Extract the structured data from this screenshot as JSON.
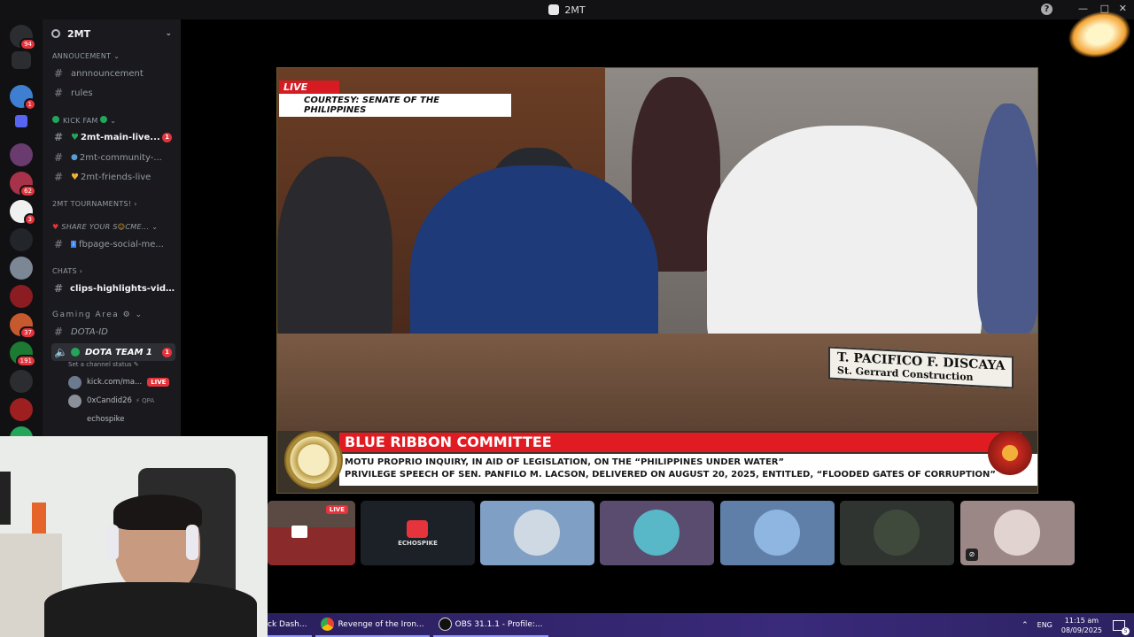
{
  "window": {
    "title": "2MT"
  },
  "server": {
    "name": "2MT"
  },
  "rail_badges": [
    "94",
    "1",
    "62",
    "3",
    "37",
    "191"
  ],
  "categories": {
    "annoucement": "ANNOUCEMENT",
    "kick_fam": "KICK FAM",
    "tournaments": "2MT TOURNAMENTS!",
    "share": "SHARE YOUR S",
    "share_tail": "CME...",
    "chats": "CHATS",
    "gaming": "Gaming Area"
  },
  "channels": [
    {
      "label": "annnouncement"
    },
    {
      "label": "rules"
    },
    {
      "label": "2mt-main-live...",
      "badge": "1"
    },
    {
      "label": "2mt-community-..."
    },
    {
      "label": "2mt-friends-live"
    },
    {
      "label": "fbpage-social-me..."
    },
    {
      "label": "clips-highlights-videos"
    },
    {
      "label": "DOTA-ID"
    }
  ],
  "voice_channel": {
    "label": "DOTA TEAM 1",
    "badge": "1",
    "status": "Set a channel status"
  },
  "voice_users": [
    {
      "name": "kick.com/ma...",
      "live": "LIVE"
    },
    {
      "name": "0xCandid26",
      "tag": "QPA"
    },
    {
      "name": "echospike"
    }
  ],
  "stream": {
    "live_tag": "LIVE",
    "courtesy": "COURTESY: SENATE OF THE PHILIPPINES",
    "nameplate_name": "T. PACIFICO F. DISCAYA",
    "nameplate_company": "St. Gerrard Construction",
    "headline": "BLUE RIBBON COMMITTEE",
    "line1": "MOTU PROPRIO INQUIRY, IN AID OF LEGISLATION, ON THE “PHILIPPINES UNDER WATER”",
    "line2": "PRIVILEGE SPEECH OF SEN. PANFILO M. LACSON, DELIVERED ON AUGUST 20, 2025, ENTITLED, “FLOODED GATES OF CORRUPTION”"
  },
  "tiles": {
    "live": "LIVE",
    "echospike": "ECHOSPIKE"
  },
  "taskbar": {
    "items": [
      "ck Dash...",
      "Revenge of the Iron...",
      "OBS 31.1.1 - Profile:..."
    ],
    "lang": "ENG",
    "time": "11:15 am",
    "date": "08/09/2025",
    "notif": "5"
  },
  "colors": {
    "accent_red": "#e5343b",
    "online_green": "#23a55a",
    "sidebar": "#1a1a1e"
  }
}
